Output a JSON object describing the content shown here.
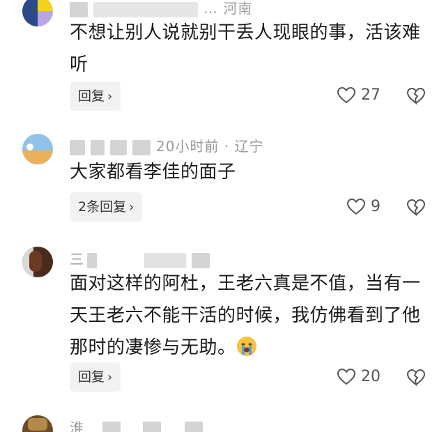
{
  "comments": [
    {
      "meta": "… 河南",
      "text_lines": [
        "不想让别人说就别干丢人现眼的事，活该难",
        "听"
      ],
      "reply_label": "回复",
      "likes": "27"
    },
    {
      "meta": "20小时前 · 辽宁",
      "text_lines": [
        "大家都看李佳的面子"
      ],
      "reply_label": "2条回复",
      "likes": "9"
    },
    {
      "meta": "三",
      "text_lines": [
        "面对这样的阿杜，王老六真是不值，当有一",
        "天王老六不能干活的时候，我仿佛看到了他",
        "那时的凄惨与无助。"
      ],
      "emoji": "crying-face",
      "reply_label": "回复",
      "likes": "20"
    },
    {
      "meta": "淮",
      "text_lines": [],
      "reply_label": "",
      "likes": ""
    }
  ],
  "colors": {
    "text": "#1a1a1a",
    "meta": "#9a9a9a",
    "reply_bg": "#f2f2f2",
    "icon": "#555555"
  }
}
